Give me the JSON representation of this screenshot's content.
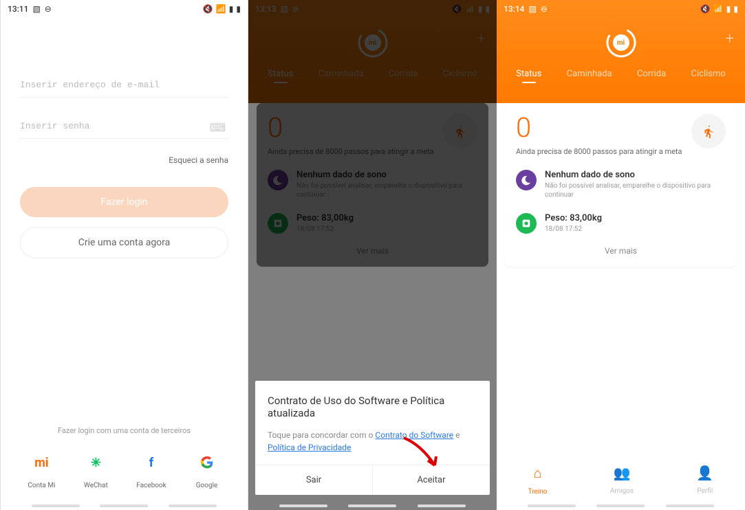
{
  "screen1": {
    "status": {
      "time": "13:11"
    },
    "email_placeholder": "Inserir endereço de e-mail",
    "password_placeholder": "Inserir senha",
    "forgot": "Esqueci a senha",
    "login_btn": "Fazer login",
    "create_btn": "Crie uma conta agora",
    "third_party_label": "Fazer login com uma conta de terceiros",
    "social": {
      "mi": "Conta Mi",
      "wechat": "WeChat",
      "facebook": "Facebook",
      "google": "Google"
    }
  },
  "screen2": {
    "status": {
      "time": "13:13"
    },
    "tabs": {
      "status": "Status",
      "walk": "Caminhada",
      "run": "Corrida",
      "cycle": "Ciclismo"
    },
    "steps": "0",
    "steps_sub": "Ainda precisa de 8000 passos para atingir a meta",
    "sleep_title": "Nenhum dado de sono",
    "sleep_sub": "Não foi possível analisar, emparelhe o dispositivo para continuar",
    "weight_title": "Peso: 83,00kg",
    "weight_sub": "18/08 17:52",
    "ver_mais": "Ver mais",
    "modal": {
      "title": "Contrato de Uso do Software e Política atualizada",
      "text_prefix": "Toque para concordar com o ",
      "link1": "Contrato do Software",
      "text_mid": " e ",
      "link2": "Política de Privacidade",
      "exit": "Sair",
      "accept": "Aceitar"
    }
  },
  "screen3": {
    "status": {
      "time": "13:14"
    },
    "tabs": {
      "status": "Status",
      "walk": "Caminhada",
      "run": "Corrida",
      "cycle": "Ciclismo"
    },
    "steps": "0",
    "steps_sub": "Ainda precisa de 8000 passos para atingir a meta",
    "sleep_title": "Nenhum dado de sono",
    "sleep_sub": "Não foi possível analisar, emparelhe o dispositivo para continuar",
    "weight_title": "Peso: 83,00kg",
    "weight_sub": "18/08 17:52",
    "ver_mais": "Ver mais",
    "nav": {
      "treino": "Treino",
      "amigos": "Amigos",
      "perfil": "Perfil"
    }
  }
}
